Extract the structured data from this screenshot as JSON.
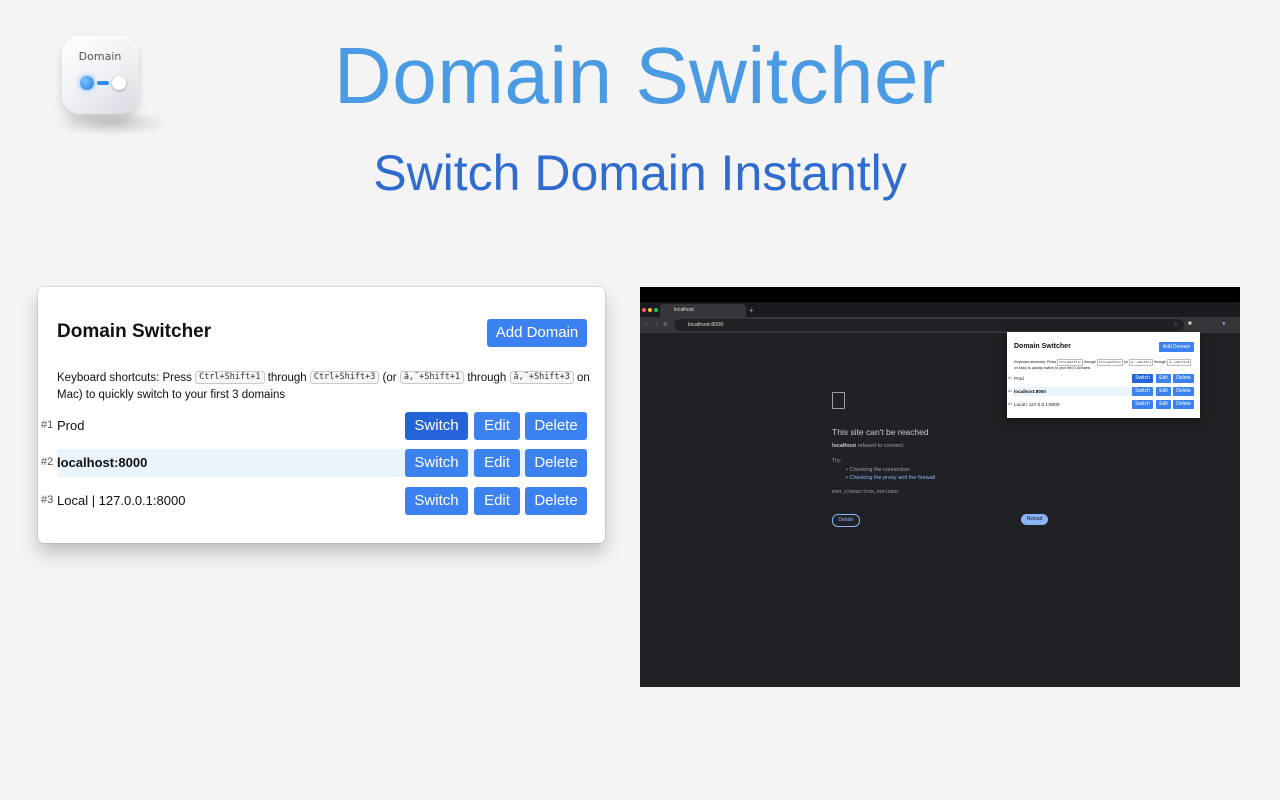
{
  "hero": {
    "logo_text": "Domain",
    "title": "Domain Switcher",
    "subtitle": "Switch Domain Instantly"
  },
  "popup": {
    "title": "Domain Switcher",
    "add_button": "Add Domain",
    "shortcuts": {
      "prefix": "Keyboard shortcuts: Press",
      "key1": "Ctrl+Shift+1",
      "through1": "through",
      "key2": "Ctrl+Shift+3",
      "or_text": "(or",
      "key3": "â‚˜+Shift+1",
      "through2": "through",
      "key4": "â‚˜+Shift+3",
      "suffix": "on Mac) to quickly switch to your first 3 domains"
    },
    "rows": [
      {
        "num": "#1",
        "label": "Prod",
        "switch": "Switch",
        "edit": "Edit",
        "delete": "Delete"
      },
      {
        "num": "#2",
        "label": "localhost:8000",
        "switch": "Switch",
        "edit": "Edit",
        "delete": "Delete"
      },
      {
        "num": "#3",
        "label": "Local | 127.0.0.1:8000",
        "switch": "Switch",
        "edit": "Edit",
        "delete": "Delete"
      }
    ]
  },
  "browser": {
    "tab_title": "localhost",
    "tab_new": "+",
    "address": "localhost:8000",
    "error": {
      "title": "This site can't be reached",
      "host": "localhost",
      "message": "refused to connect.",
      "try_label": "Try:",
      "suggestion1": "Checking the connection",
      "suggestion2": "Checking the proxy and the firewall",
      "code": "ERR_CONNECTION_REFUSED",
      "details_button": "Details",
      "reload_button": "Reload"
    },
    "mini_popup": {
      "title": "Domain Switcher",
      "add_button": "Add Domain",
      "shortcuts_prefix": "Keyboard shortcuts: Press",
      "key1": "Ctrl+Shift+1",
      "through1": "through",
      "key2": "Ctrl+Shift+3",
      "or_text": "(or",
      "key3": "â‚˜+Shift+1",
      "through2": "through",
      "key4": "â‚˜+Shift+3",
      "shortcuts_suffix": "on Mac) to quickly switch to your first 3 domains",
      "rows": [
        {
          "num": "#1",
          "label": "Prod",
          "switch": "Switch",
          "edit": "Edit",
          "delete": "Delete"
        },
        {
          "num": "#2",
          "label": "localhost:8000",
          "switch": "Switch",
          "edit": "Edit",
          "delete": "Delete"
        },
        {
          "num": "#3",
          "label": "Local | 127.0.0.1:8000",
          "switch": "Switch",
          "edit": "Edit",
          "delete": "Delete"
        }
      ]
    }
  },
  "colors": {
    "accent": "#3b82f0",
    "accent_active": "#2563d8",
    "title_blue": "#4a9be3",
    "subtitle_blue": "#2f6cd0",
    "active_row_bg": "#eaf4fd"
  }
}
